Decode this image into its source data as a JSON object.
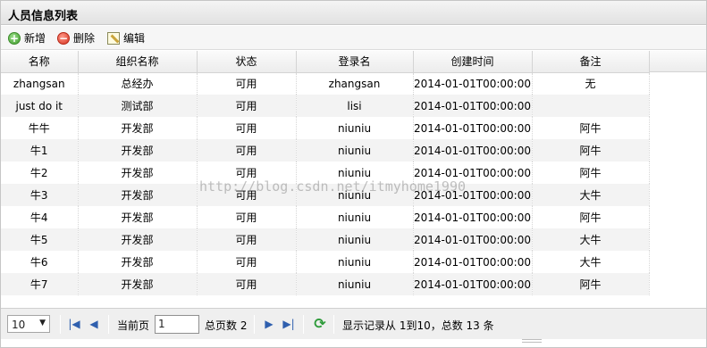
{
  "panel": {
    "title": "人员信息列表"
  },
  "toolbar": {
    "add_label": "新增",
    "delete_label": "删除",
    "edit_label": "编辑",
    "add_icon": "add-icon",
    "delete_icon": "delete-icon",
    "edit_icon": "edit-icon"
  },
  "table": {
    "columns": [
      "名称",
      "组织名称",
      "状态",
      "登录名",
      "创建时间",
      "备注"
    ],
    "rows": [
      [
        "zhangsan",
        "总经办",
        "可用",
        "zhangsan",
        "2014-01-01T00:00:00",
        "无"
      ],
      [
        "just do it",
        "测试部",
        "可用",
        "lisi",
        "2014-01-01T00:00:00",
        ""
      ],
      [
        "牛牛",
        "开发部",
        "可用",
        "niuniu",
        "2014-01-01T00:00:00",
        "阿牛"
      ],
      [
        "牛1",
        "开发部",
        "可用",
        "niuniu",
        "2014-01-01T00:00:00",
        "阿牛"
      ],
      [
        "牛2",
        "开发部",
        "可用",
        "niuniu",
        "2014-01-01T00:00:00",
        "阿牛"
      ],
      [
        "牛3",
        "开发部",
        "可用",
        "niuniu",
        "2014-01-01T00:00:00",
        "大牛"
      ],
      [
        "牛4",
        "开发部",
        "可用",
        "niuniu",
        "2014-01-01T00:00:00",
        "阿牛"
      ],
      [
        "牛5",
        "开发部",
        "可用",
        "niuniu",
        "2014-01-01T00:00:00",
        "大牛"
      ],
      [
        "牛6",
        "开发部",
        "可用",
        "niuniu",
        "2014-01-01T00:00:00",
        "大牛"
      ],
      [
        "牛7",
        "开发部",
        "可用",
        "niuniu",
        "2014-01-01T00:00:00",
        "阿牛"
      ]
    ]
  },
  "watermark": "http://blog.csdn.net/itmyhome1990",
  "pager": {
    "page_size": "10",
    "current_page_label": "当前页",
    "current_page_value": "1",
    "total_pages_label": "总页数 2",
    "records_info": "显示记录从 1到10，总数 13 条",
    "first_icon": "first-page-icon",
    "prev_icon": "prev-page-icon",
    "next_icon": "next-page-icon",
    "last_icon": "last-page-icon",
    "refresh_icon": "refresh-icon"
  }
}
